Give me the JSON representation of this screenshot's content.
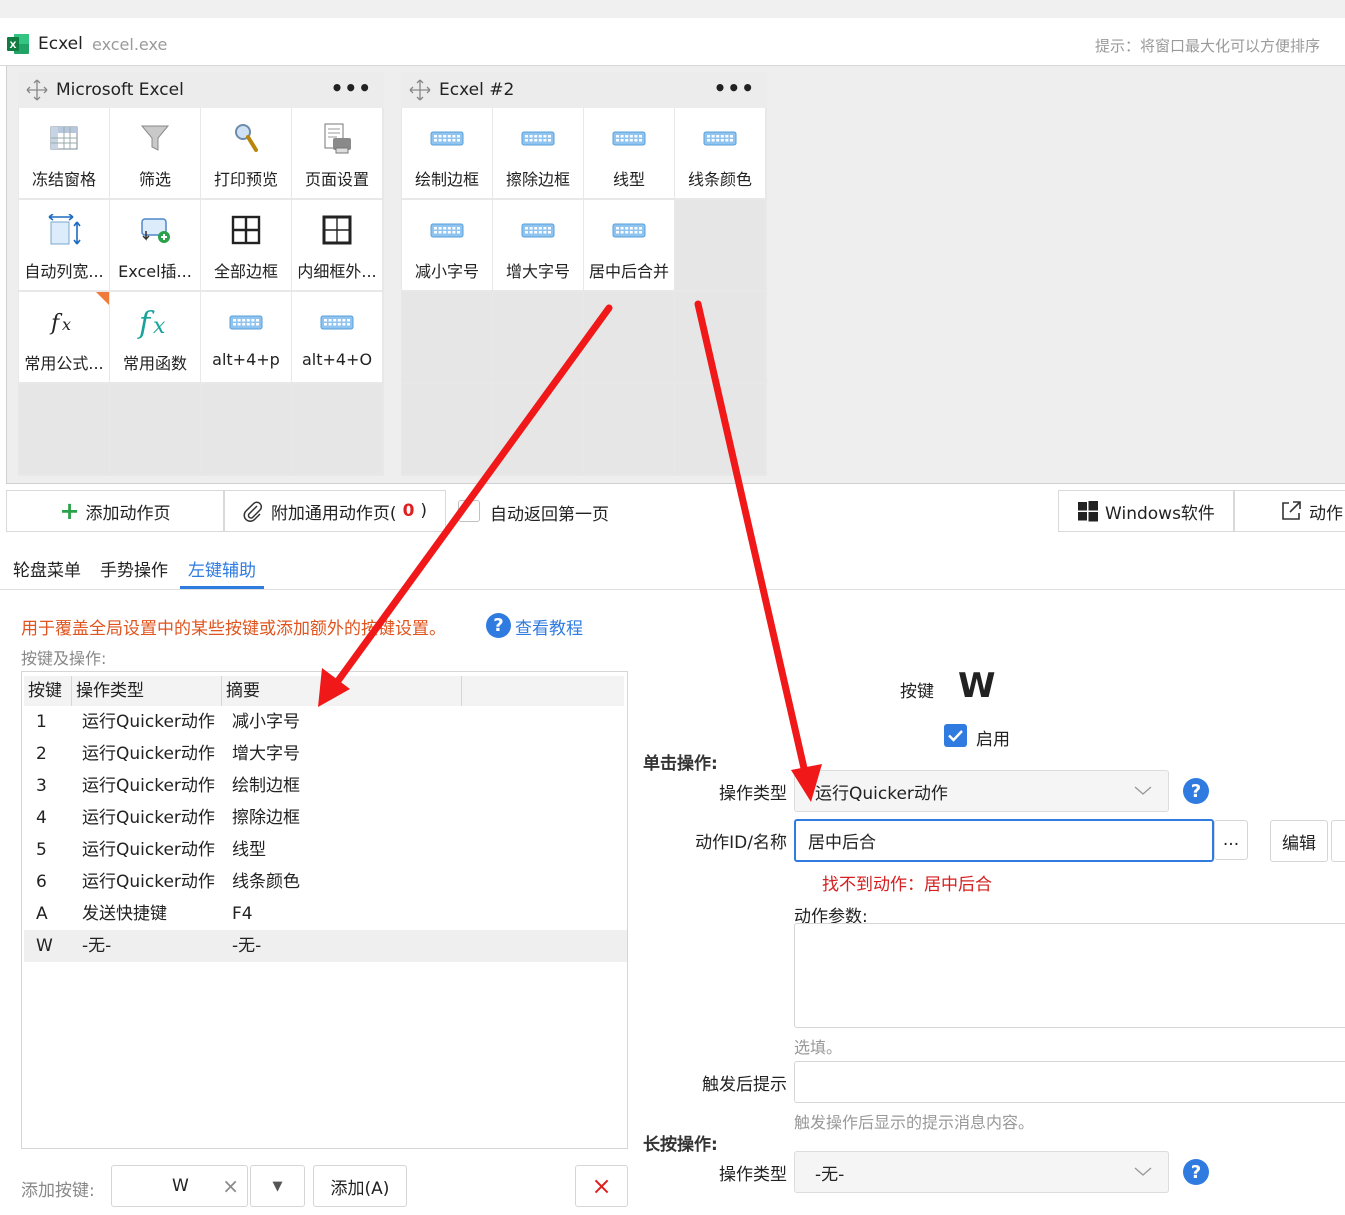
{
  "window": {
    "app_name": "Ecxel",
    "exe_name": "excel.exe",
    "hint": "提示：将窗口最大化可以方便排序"
  },
  "panels": [
    {
      "title": "Microsoft Excel",
      "menu": "•••",
      "cells": [
        {
          "label": "冻结窗格",
          "icon": "freeze-panes-icon"
        },
        {
          "label": "筛选",
          "icon": "filter-icon"
        },
        {
          "label": "打印预览",
          "icon": "print-preview-icon"
        },
        {
          "label": "页面设置",
          "icon": "page-setup-icon"
        },
        {
          "label": "自动列宽...",
          "icon": "autofit-column-icon"
        },
        {
          "label": "Excel插...",
          "icon": "excel-plugin-icon"
        },
        {
          "label": "全部边框",
          "icon": "all-borders-icon"
        },
        {
          "label": "内细框外...",
          "icon": "inner-outer-border-icon"
        },
        {
          "label": "常用公式...",
          "icon": "formula-icon"
        },
        {
          "label": "常用函数",
          "icon": "function-icon"
        },
        {
          "label": "alt+4+p",
          "icon": "keyboard-icon"
        },
        {
          "label": "alt+4+O",
          "icon": "keyboard-icon"
        }
      ]
    },
    {
      "title": "Ecxel #2",
      "menu": "•••",
      "cells": [
        {
          "label": "绘制边框",
          "icon": "keyboard-icon"
        },
        {
          "label": "擦除边框",
          "icon": "keyboard-icon"
        },
        {
          "label": "线型",
          "icon": "keyboard-icon"
        },
        {
          "label": "线条颜色",
          "icon": "keyboard-icon"
        },
        {
          "label": "减小字号",
          "icon": "keyboard-icon"
        },
        {
          "label": "增大字号",
          "icon": "keyboard-icon"
        },
        {
          "label": "居中后合并",
          "icon": "keyboard-icon"
        }
      ]
    }
  ],
  "toolbar": {
    "add_page": "添加动作页",
    "attach_common": "附加通用动作页(",
    "attach_count": "0",
    "attach_close": ")",
    "auto_return": "自动返回第一页",
    "windows_soft": "Windows软件",
    "actions": "动作"
  },
  "tabs": [
    "轮盘菜单",
    "手势操作",
    "左键辅助"
  ],
  "active_tab": 2,
  "description": "用于覆盖全局设置中的某些按键或添加额外的按键设置。",
  "tutorial_link": "查看教程",
  "keys_label": "按键及操作:",
  "table": {
    "headers": [
      "按键",
      "操作类型",
      "摘要"
    ],
    "rows": [
      {
        "key": "1",
        "type": "运行Quicker动作",
        "summary": "减小字号"
      },
      {
        "key": "2",
        "type": "运行Quicker动作",
        "summary": "增大字号"
      },
      {
        "key": "3",
        "type": "运行Quicker动作",
        "summary": "绘制边框"
      },
      {
        "key": "4",
        "type": "运行Quicker动作",
        "summary": "擦除边框"
      },
      {
        "key": "5",
        "type": "运行Quicker动作",
        "summary": "线型"
      },
      {
        "key": "6",
        "type": "运行Quicker动作",
        "summary": "线条颜色"
      },
      {
        "key": "A",
        "type": "发送快捷键",
        "summary": "F4"
      },
      {
        "key": "W",
        "type": "-无-",
        "summary": "-无-"
      }
    ],
    "selected_row": 7
  },
  "add_key": {
    "label": "添加按键:",
    "value": "W",
    "clear": "×",
    "dropdown": "▼",
    "add_button": "添加(A)",
    "delete": "×"
  },
  "form": {
    "key_label": "按键",
    "key_value": "W",
    "enabled_label": "启用",
    "enabled": true,
    "click_section": "单击操作:",
    "op_type_label": "操作类型",
    "op_type_value": "运行Quicker动作",
    "action_id_label": "动作ID/名称",
    "action_id_value": "居中后合",
    "browse": "...",
    "edit": "编辑",
    "error": "找不到动作：居中后合",
    "params_label": "动作参数:",
    "params_hint": "选填。",
    "trigger_label": "触发后提示",
    "trigger_hint": "触发操作后显示的提示消息内容。",
    "long_section": "长按操作:",
    "long_op_label": "操作类型",
    "long_op_value": "-无-"
  },
  "colors": {
    "accent": "#2f7be0",
    "error": "#d42020",
    "description": "#e0551f",
    "arrow": "#f01818"
  }
}
